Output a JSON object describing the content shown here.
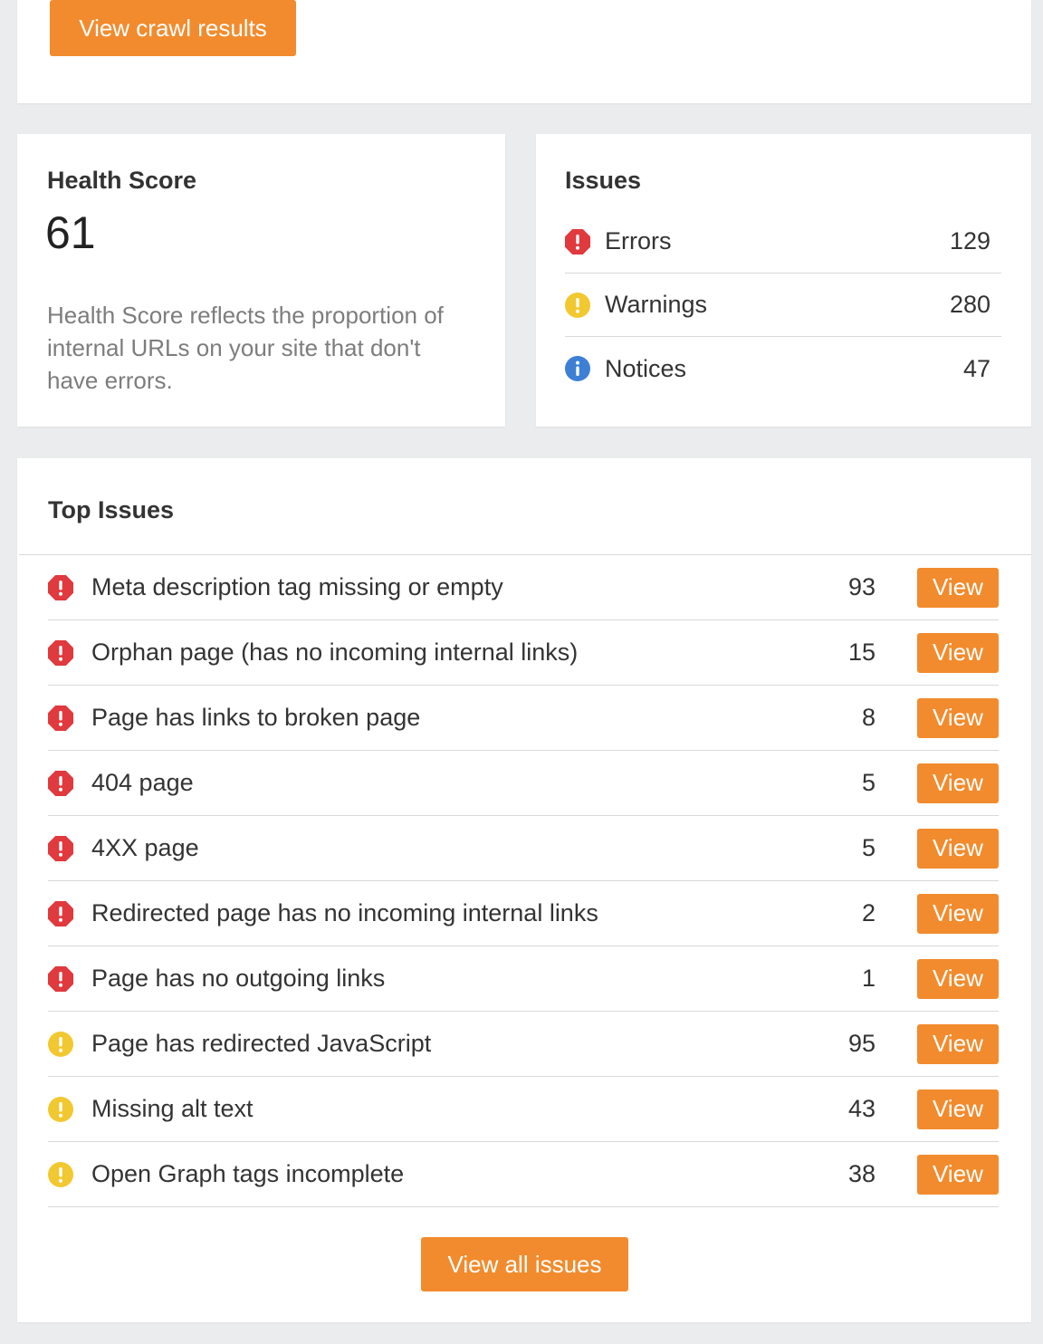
{
  "top": {
    "crawl_button": "View crawl results"
  },
  "health": {
    "title": "Health Score",
    "score": "61",
    "description": "Health Score reflects the proportion of internal URLs on your site that don't have errors."
  },
  "issues_summary": {
    "title": "Issues",
    "rows": [
      {
        "label": "Errors",
        "count": "129",
        "icon": "error-icon"
      },
      {
        "label": "Warnings",
        "count": "280",
        "icon": "warning-icon"
      },
      {
        "label": "Notices",
        "count": "47",
        "icon": "info-icon"
      }
    ]
  },
  "top_issues": {
    "title": "Top Issues",
    "view_label": "View",
    "rows": [
      {
        "label": "Meta description tag missing or empty",
        "count": "93",
        "severity": "error"
      },
      {
        "label": "Orphan page (has no incoming internal links)",
        "count": "15",
        "severity": "error"
      },
      {
        "label": "Page has links to broken page",
        "count": "8",
        "severity": "error"
      },
      {
        "label": "404 page",
        "count": "5",
        "severity": "error"
      },
      {
        "label": "4XX page",
        "count": "5",
        "severity": "error"
      },
      {
        "label": "Redirected page has no incoming internal links",
        "count": "2",
        "severity": "error"
      },
      {
        "label": "Page has no outgoing links",
        "count": "1",
        "severity": "error"
      },
      {
        "label": "Page has redirected JavaScript",
        "count": "95",
        "severity": "warning"
      },
      {
        "label": "Missing alt text",
        "count": "43",
        "severity": "warning"
      },
      {
        "label": "Open Graph tags incomplete",
        "count": "38",
        "severity": "warning"
      }
    ],
    "all_button": "View all issues"
  },
  "colors": {
    "accent": "#f28b2d",
    "error": "#e0393e",
    "warning": "#f2c830",
    "info": "#3e7fd6"
  }
}
